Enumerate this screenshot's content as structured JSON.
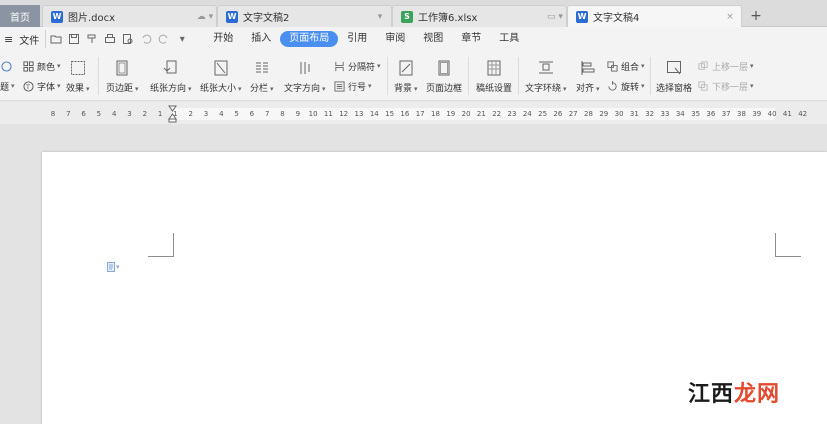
{
  "tabs": {
    "home": "首页",
    "items": [
      {
        "label": "图片.docx",
        "type": "w"
      },
      {
        "label": "文字文稿2",
        "type": "w"
      },
      {
        "label": "工作簿6.xlsx",
        "type": "s"
      },
      {
        "label": "文字文稿4",
        "type": "w"
      }
    ],
    "new_tab": "+",
    "close": "×"
  },
  "menubar": {
    "file": "文件",
    "items": [
      "开始",
      "插入",
      "页面布局",
      "引用",
      "审阅",
      "视图",
      "章节",
      "工具"
    ],
    "active": "页面布局"
  },
  "ribbon": {
    "color": "颜色",
    "font": "字体",
    "effect": "效果",
    "margins": "页边距",
    "orientation": "纸张方向",
    "size": "纸张大小",
    "columns": "分栏",
    "text_direction": "文字方向",
    "breaks": "分隔符",
    "line_numbers": "行号",
    "background": "背景",
    "page_border": "页面边框",
    "manuscript": "稿纸设置",
    "text_wrap": "文字环绕",
    "align": "对齐",
    "group": "组合",
    "rotate": "旋转",
    "selection_pane": "选择窗格",
    "bring_forward": "上移一层",
    "send_backward": "下移一层",
    "theme_left": "题"
  },
  "ruler": {
    "numbers": [
      "8",
      "7",
      "6",
      "5",
      "4",
      "3",
      "2",
      "1",
      "1",
      "2",
      "3",
      "4",
      "5",
      "6",
      "7",
      "8",
      "9",
      "10",
      "11",
      "12",
      "13",
      "14",
      "15",
      "16",
      "17",
      "18",
      "19",
      "20",
      "21",
      "22",
      "23",
      "24",
      "25",
      "26",
      "27",
      "28",
      "29",
      "30",
      "31",
      "32",
      "33",
      "34",
      "35",
      "36",
      "37",
      "38",
      "39",
      "40",
      "41",
      "42"
    ]
  },
  "watermark": {
    "part1": "江西",
    "part2": "龙网"
  },
  "colors": {
    "accent": "#4a8ff0",
    "doc_blue": "#2b6bd6",
    "xls_green": "#3aa35a"
  }
}
